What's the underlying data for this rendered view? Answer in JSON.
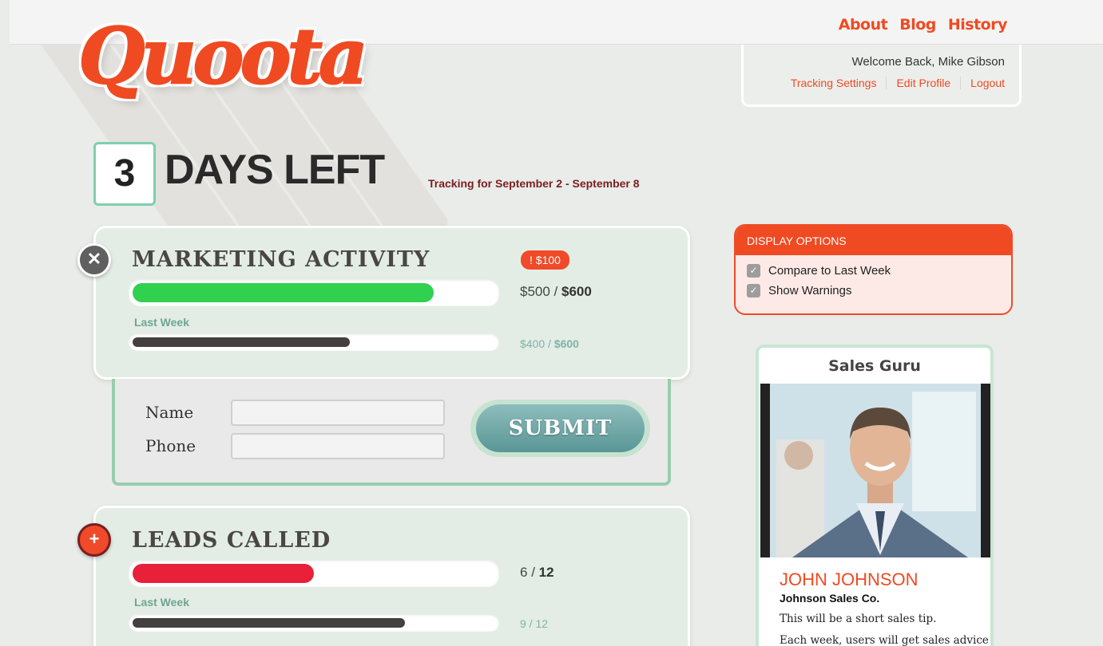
{
  "nav": {
    "about": "About",
    "blog": "Blog",
    "history": "History"
  },
  "logo": {
    "text": "Quoota"
  },
  "user": {
    "welcome": "Welcome Back, Mike Gibson",
    "links": [
      "Tracking Settings",
      "Edit Profile",
      "Logout"
    ]
  },
  "countdown": {
    "days": "3",
    "label": "DAYS LEFT",
    "tracking": "Tracking for September 2 - September 8"
  },
  "metrics": [
    {
      "title": "MARKETING ACTIVITY",
      "warning": "! $100",
      "current": "$500",
      "goal": "$600",
      "progress": 0.83,
      "bar_color": "#2fd14e",
      "last_week_label": "Last Week",
      "last_current": "$400",
      "last_goal": "$600",
      "last_progress": 0.6,
      "toggle_icon": "close-icon"
    },
    {
      "title": "LEADS CALLED",
      "current": "6",
      "goal": "12",
      "progress": 0.5,
      "bar_color": "#e8203a",
      "last_week_label": "Last Week",
      "last_current": "9",
      "last_goal": "12",
      "last_progress": 0.75,
      "toggle_icon": "plus-icon"
    }
  ],
  "form": {
    "name_label": "Name",
    "phone_label": "Phone",
    "name_value": "",
    "phone_value": "",
    "submit": "SUBMIT"
  },
  "display_options": {
    "title": "DISPLAY OPTIONS",
    "options": [
      {
        "label": "Compare to Last Week",
        "checked": true
      },
      {
        "label": "Show Warnings",
        "checked": true
      }
    ]
  },
  "sales_guru": {
    "title": "Sales Guru",
    "name": "JOHN JOHNSON",
    "company": "Johnson Sales Co.",
    "tip_line1": "This will be a short sales tip.",
    "tip_line2": "Each week, users will get sales advice"
  },
  "colors": {
    "accent": "#f04a22",
    "green": "#2fd14e",
    "red": "#e8203a",
    "teal": "#7ed0ad"
  }
}
